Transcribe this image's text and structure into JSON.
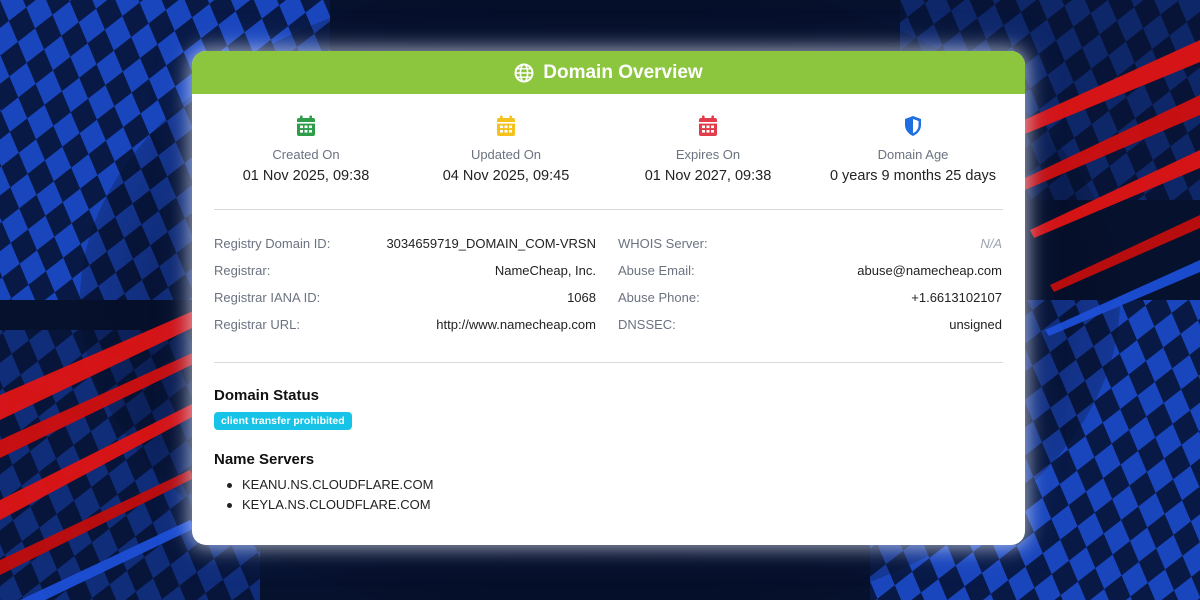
{
  "header": {
    "title": "Domain Overview",
    "icon": "globe-icon"
  },
  "stats": [
    {
      "label": "Created On",
      "value": "01 Nov 2025, 09:38",
      "icon": "calendar-icon",
      "color": "#2e9d4a"
    },
    {
      "label": "Updated On",
      "value": "04 Nov 2025, 09:45",
      "icon": "calendar-icon",
      "color": "#f5c21b"
    },
    {
      "label": "Expires On",
      "value": "01 Nov 2027, 09:38",
      "icon": "calendar-icon",
      "color": "#e23b4a"
    },
    {
      "label": "Domain Age",
      "value": "0 years 9 months 25 days",
      "icon": "shield-icon",
      "color": "#1f6fe0"
    }
  ],
  "details_left": [
    {
      "key": "Registry Domain ID:",
      "value": "3034659719_DOMAIN_COM-VRSN"
    },
    {
      "key": "Registrar:",
      "value": "NameCheap, Inc."
    },
    {
      "key": "Registrar IANA ID:",
      "value": "1068"
    },
    {
      "key": "Registrar URL:",
      "value": "http://www.namecheap.com"
    }
  ],
  "details_right": [
    {
      "key": "WHOIS Server:",
      "value": "N/A"
    },
    {
      "key": "Abuse Email:",
      "value": "abuse@namecheap.com"
    },
    {
      "key": "Abuse Phone:",
      "value": "+1.6613102107"
    },
    {
      "key": "DNSSEC:",
      "value": "unsigned"
    }
  ],
  "domain_status": {
    "title": "Domain Status",
    "badges": [
      "client transfer prohibited"
    ],
    "badge_color": "#17c4e8"
  },
  "name_servers": {
    "title": "Name Servers",
    "items": [
      "KEANU.NS.CLOUDFLARE.COM",
      "KEYLA.NS.CLOUDFLARE.COM"
    ]
  },
  "colors": {
    "accent": "#8cc63f",
    "background": "#06112e"
  }
}
